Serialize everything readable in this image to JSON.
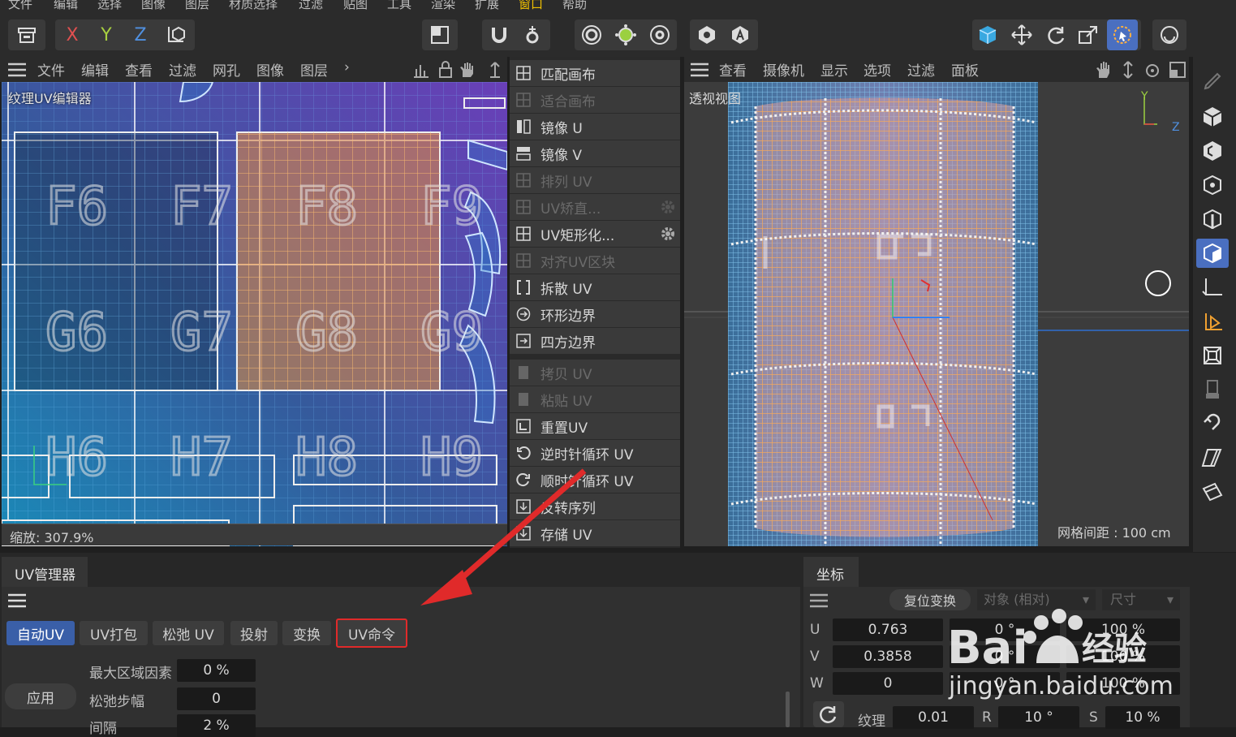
{
  "menubar": {
    "items": [
      "文件",
      "编辑",
      "选择",
      "图像",
      "图层",
      "材质选择",
      "过滤",
      "贴图",
      "工具",
      "渲染",
      "扩展",
      "窗口",
      "帮助"
    ]
  },
  "toolbar": {
    "axis_x": "X",
    "axis_y": "Y",
    "axis_z": "Z"
  },
  "uv_editor": {
    "menu": [
      "文件",
      "编辑",
      "查看",
      "过滤",
      "网孔",
      "图像",
      "图层"
    ],
    "more": "›",
    "title": "纹理UV编辑器",
    "zoom": "缩放: 307.9%",
    "tile_labels": [
      "F6",
      "F7",
      "F8",
      "F9",
      "G6",
      "G7",
      "G8",
      "G9",
      "H6",
      "H7",
      "H8",
      "H9"
    ]
  },
  "commands": [
    {
      "label": "匹配画布",
      "enabled": true
    },
    {
      "label": "适合画布",
      "enabled": false
    },
    {
      "label": "镜像 U",
      "enabled": true
    },
    {
      "label": "镜像 V",
      "enabled": true
    },
    {
      "label": "排列 UV",
      "enabled": false
    },
    {
      "label": "UV矫直...",
      "enabled": false
    },
    {
      "label": "UV矩形化...",
      "enabled": true
    },
    {
      "label": "对齐UV区块",
      "enabled": false
    },
    {
      "label": "拆散 UV",
      "enabled": true
    },
    {
      "label": "环形边界",
      "enabled": true
    },
    {
      "label": "四方边界",
      "enabled": true
    },
    {
      "label": "拷贝 UV",
      "enabled": false
    },
    {
      "label": "粘贴 UV",
      "enabled": false
    },
    {
      "label": "重置UV",
      "enabled": true
    },
    {
      "label": "逆时针循环 UV",
      "enabled": true
    },
    {
      "label": "顺时针循环 UV",
      "enabled": true
    },
    {
      "label": "反转序列",
      "enabled": true
    },
    {
      "label": "存储 UV",
      "enabled": true
    }
  ],
  "viewport": {
    "menu": [
      "查看",
      "摄像机",
      "显示",
      "选项",
      "过滤",
      "面板"
    ],
    "title": "透视视图",
    "grid_spacing": "网格间距 : 100 cm",
    "axis_y": "Y",
    "axis_z": "Z"
  },
  "uv_manager": {
    "title": "UV管理器",
    "tabs": [
      "自动UV",
      "UV打包",
      "松弛 UV",
      "投射",
      "变换",
      "UV命令"
    ],
    "active_tab": "自动UV",
    "highlighted_tab": "UV命令",
    "apply_button": "应用",
    "fields": [
      {
        "label": "最大区域因素",
        "value": "0 %"
      },
      {
        "label": "松弛步幅",
        "value": "0"
      },
      {
        "label": "间隔",
        "value": "2 %"
      }
    ]
  },
  "coords": {
    "title": "坐标",
    "reset_button": "复位变换",
    "mode_select": "对象 (相对)",
    "size_select": "尺寸",
    "rows": [
      {
        "axis": "U",
        "pos": "0.763",
        "rot": "0 °",
        "scale": "100 %"
      },
      {
        "axis": "V",
        "pos": "0.3858",
        "rot": "0 °",
        "scale": "100 %"
      },
      {
        "axis": "W",
        "pos": "0",
        "rot": "0 °",
        "scale": "100 %"
      }
    ],
    "texture_label": "纹理",
    "texture_value": "0.01",
    "r_label": "R",
    "r_value": "10 °",
    "s_label": "S",
    "s_value": "10 %"
  },
  "watermark": {
    "brand": "Bai",
    "brand2": "经验",
    "url": "jingyan.baidu.com"
  },
  "colors": {
    "accent_blue": "#3a5fa8",
    "highlight_red": "#e02a2a",
    "selection_orange": "#e8a060"
  }
}
